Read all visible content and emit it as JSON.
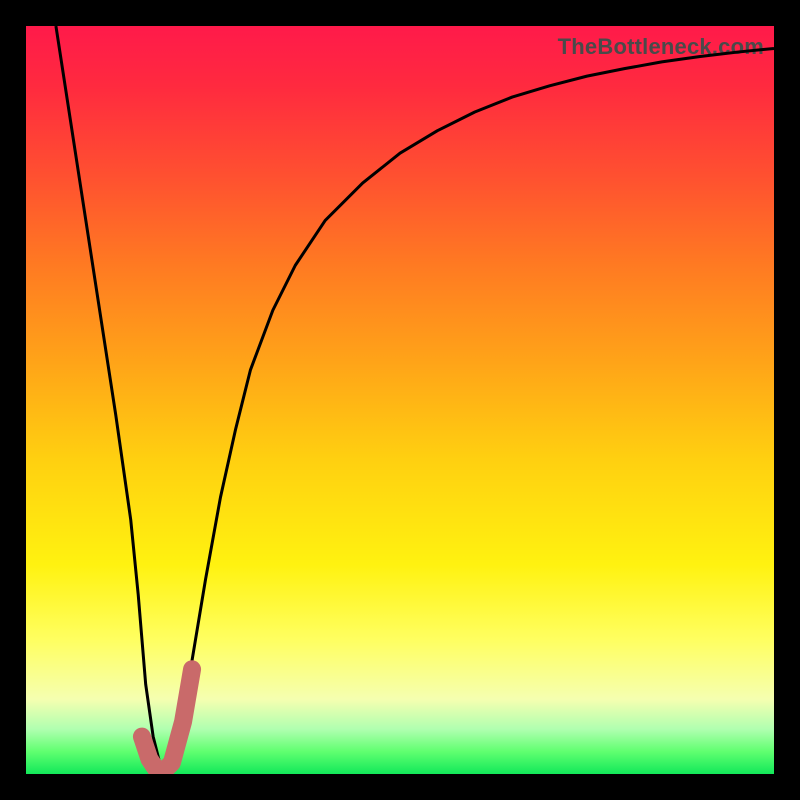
{
  "watermark": "TheBottleneck.com",
  "chart_data": {
    "type": "line",
    "title": "",
    "xlabel": "",
    "ylabel": "",
    "xlim": [
      0,
      100
    ],
    "ylim": [
      0,
      100
    ],
    "grid": false,
    "series": [
      {
        "name": "bottleneck-curve",
        "color": "#000000",
        "stroke_width": 3,
        "x": [
          4,
          6,
          8,
          10,
          12,
          14,
          15,
          16,
          17,
          18,
          19,
          20,
          22,
          24,
          26,
          28,
          30,
          33,
          36,
          40,
          45,
          50,
          55,
          60,
          65,
          70,
          75,
          80,
          85,
          90,
          95,
          100
        ],
        "y": [
          100,
          87,
          74,
          61,
          48,
          34,
          24,
          12,
          5,
          1,
          0,
          3,
          14,
          26,
          37,
          46,
          54,
          62,
          68,
          74,
          79,
          83,
          86,
          88.5,
          90.5,
          92,
          93.3,
          94.3,
          95.2,
          95.9,
          96.5,
          97
        ]
      },
      {
        "name": "highlight-j-mark",
        "color": "#c96a6a",
        "stroke_width": 18,
        "linecap": "round",
        "x": [
          15.5,
          16.5,
          17.5,
          18.5,
          19.5,
          21.0,
          22.2
        ],
        "y": [
          5,
          2,
          0.5,
          0.5,
          1.5,
          7,
          14
        ]
      }
    ],
    "background": {
      "type": "vertical-gradient",
      "stops": [
        {
          "pos": 0,
          "color": "#ff1a4a"
        },
        {
          "pos": 20,
          "color": "#ff5030"
        },
        {
          "pos": 45,
          "color": "#ffa418"
        },
        {
          "pos": 72,
          "color": "#fff210"
        },
        {
          "pos": 90,
          "color": "#f5ffb0"
        },
        {
          "pos": 100,
          "color": "#12e85a"
        }
      ]
    }
  }
}
